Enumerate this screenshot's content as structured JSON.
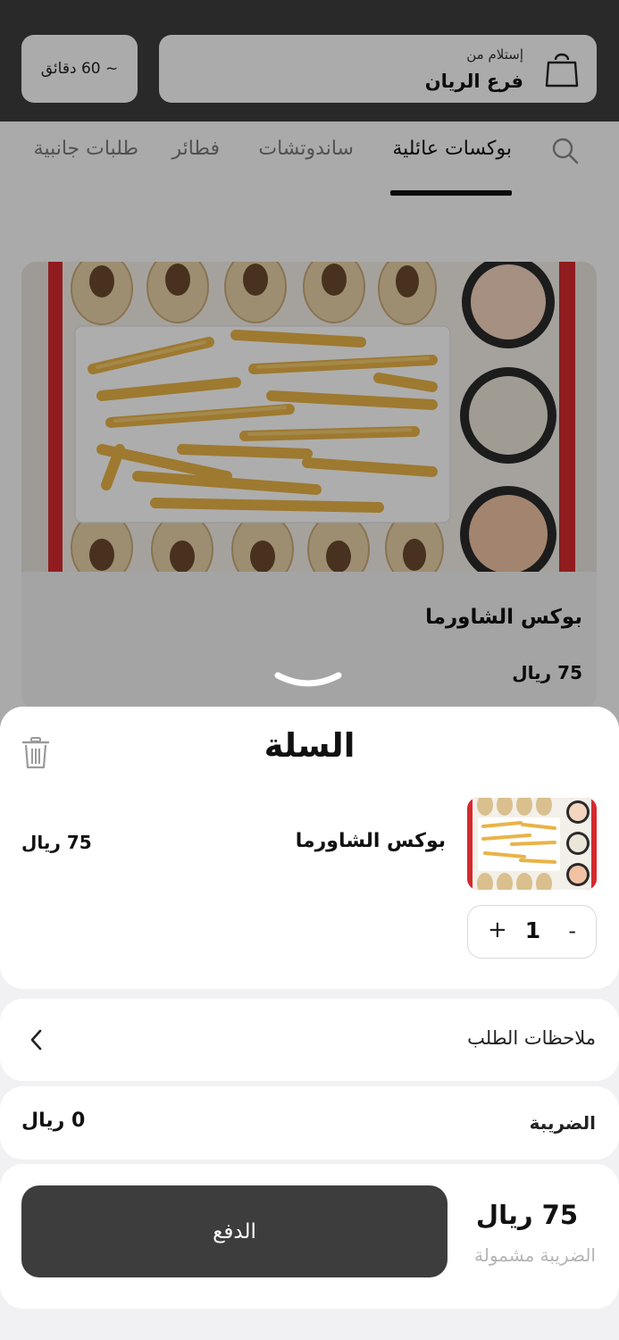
{
  "header": {
    "pickup_label": "إستلام من",
    "branch_name": "فرع الريان",
    "eta": "~ 60 دقائق"
  },
  "tabs": [
    {
      "label": "بوكسات عائلية",
      "active": true
    },
    {
      "label": "ساندوتشات",
      "active": false
    },
    {
      "label": "فطائر",
      "active": false
    },
    {
      "label": "طلبات جانبية",
      "active": false
    }
  ],
  "product": {
    "name": "بوكس الشاورما",
    "price": "75 ريال"
  },
  "cart": {
    "title": "السلة",
    "items": [
      {
        "name": "بوكس الشاورما",
        "price": "75 ريال",
        "quantity": "1"
      }
    ],
    "qty_minus": "-",
    "qty_plus": "+",
    "notes_label": "ملاحظات الطلب",
    "tax_label": "الضريبة",
    "tax_value": "0 ريال",
    "total": "75 ريال",
    "total_note": "الضريبة مشمولة",
    "pay_label": "الدفع"
  },
  "colors": {
    "header_bg": "#3d3d3d",
    "pay_button": "#3d3d3d",
    "accent_red": "#d42a2f"
  }
}
